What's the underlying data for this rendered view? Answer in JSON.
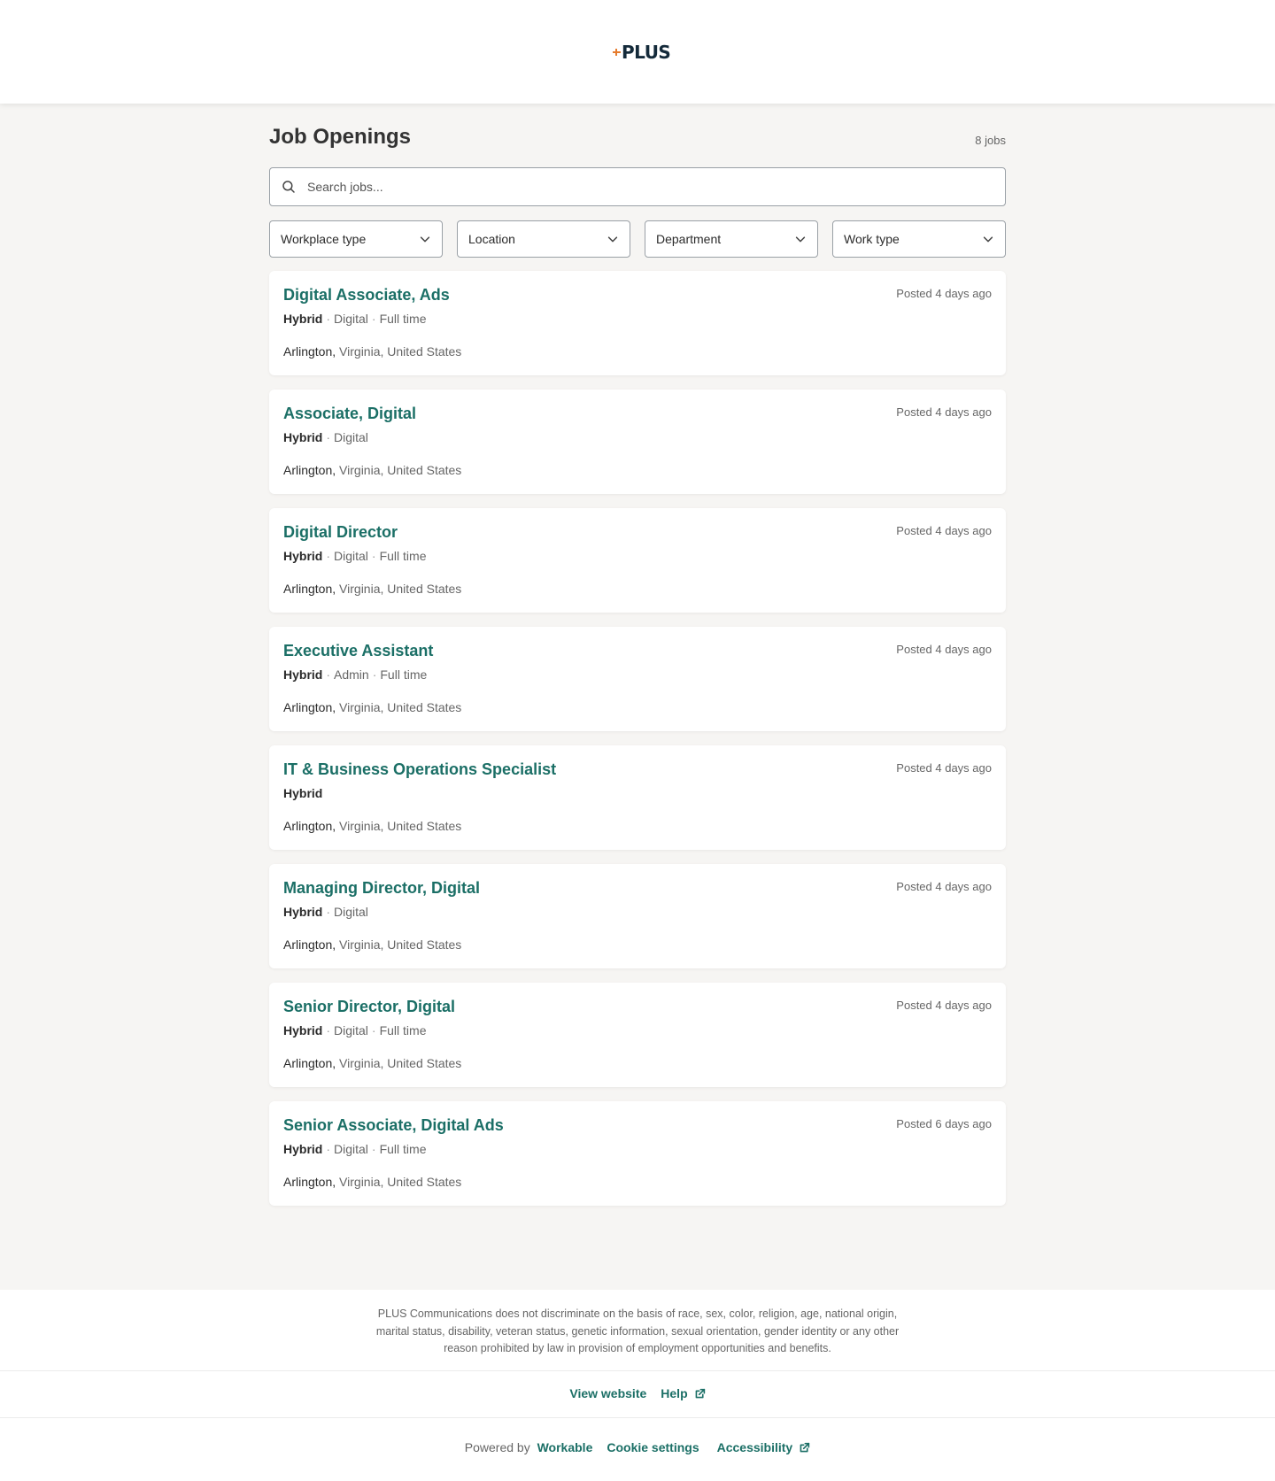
{
  "brand": {
    "logo_text": "PLUS",
    "accent_color": "#1b6f66",
    "logo_mark_color": "#e57b2d"
  },
  "page": {
    "title": "Job Openings",
    "job_count": "8 jobs"
  },
  "search": {
    "placeholder": "Search jobs..."
  },
  "filters": {
    "workplace_type": "Workplace type",
    "location": "Location",
    "department": "Department",
    "work_type": "Work type"
  },
  "jobs": [
    {
      "title": "Digital Associate, Ads",
      "posted": "Posted 4 days ago",
      "workplace": "Hybrid",
      "department": "Digital",
      "work_type": "Full time",
      "city": "Arlington,",
      "region": " Virginia, United States"
    },
    {
      "title": "Associate, Digital",
      "posted": "Posted 4 days ago",
      "workplace": "Hybrid",
      "department": "Digital",
      "work_type": "",
      "city": "Arlington,",
      "region": " Virginia, United States"
    },
    {
      "title": "Digital Director",
      "posted": "Posted 4 days ago",
      "workplace": "Hybrid",
      "department": "Digital",
      "work_type": "Full time",
      "city": "Arlington,",
      "region": " Virginia, United States"
    },
    {
      "title": "Executive Assistant",
      "posted": "Posted 4 days ago",
      "workplace": "Hybrid",
      "department": "Admin",
      "work_type": "Full time",
      "city": "Arlington,",
      "region": " Virginia, United States"
    },
    {
      "title": "IT & Business Operations Specialist",
      "posted": "Posted 4 days ago",
      "workplace": "Hybrid",
      "department": "",
      "work_type": "",
      "city": "Arlington,",
      "region": " Virginia, United States"
    },
    {
      "title": "Managing Director, Digital",
      "posted": "Posted 4 days ago",
      "workplace": "Hybrid",
      "department": "Digital",
      "work_type": "",
      "city": "Arlington,",
      "region": " Virginia, United States"
    },
    {
      "title": "Senior Director, Digital",
      "posted": "Posted 4 days ago",
      "workplace": "Hybrid",
      "department": "Digital",
      "work_type": "Full time",
      "city": "Arlington,",
      "region": " Virginia, United States"
    },
    {
      "title": "Senior Associate, Digital Ads",
      "posted": "Posted 6 days ago",
      "workplace": "Hybrid",
      "department": "Digital",
      "work_type": "Full time",
      "city": "Arlington,",
      "region": " Virginia, United States"
    }
  ],
  "footer": {
    "disclaimer": "PLUS Communications does not discriminate on the basis of race, sex, color, religion, age, national origin, marital status, disability, veteran status, genetic information, sexual orientation, gender identity or any other reason prohibited by law in provision of employment opportunities and benefits.",
    "view_website": "View website",
    "help": "Help",
    "powered_by": "Powered by",
    "workable": "Workable",
    "cookie_settings": "Cookie settings",
    "accessibility": "Accessibility"
  }
}
